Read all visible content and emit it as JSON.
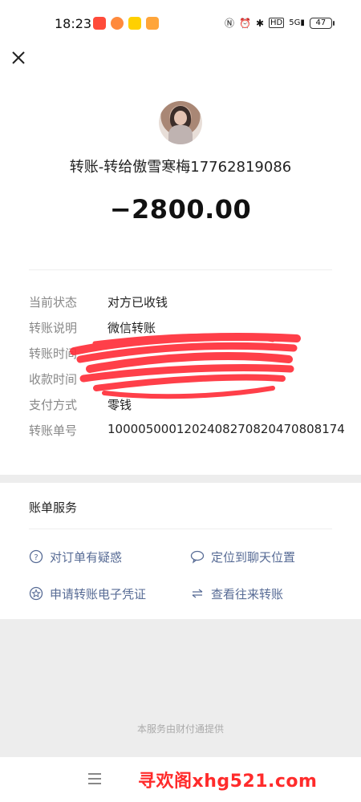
{
  "status_bar": {
    "time": "18:23",
    "network": "5G",
    "hd": "HD",
    "battery": "47"
  },
  "transfer": {
    "title": "转账-转给傲雪寒梅17762819086",
    "amount": "−2800.00"
  },
  "details": [
    {
      "label": "当前状态",
      "value": "对方已收钱"
    },
    {
      "label": "转账说明",
      "value": "微信转账"
    },
    {
      "label": "转账时间",
      "value": ""
    },
    {
      "label": "收款时间",
      "value": ""
    },
    {
      "label": "支付方式",
      "value": "零钱"
    },
    {
      "label": "转账单号",
      "value": "1000050001202408270820470808174"
    }
  ],
  "services": {
    "title": "账单服务",
    "items": [
      {
        "label": "对订单有疑惑",
        "icon": "question-circle-icon"
      },
      {
        "label": "定位到聊天位置",
        "icon": "chat-bubble-icon"
      },
      {
        "label": "申请转账电子凭证",
        "icon": "star-badge-icon"
      },
      {
        "label": "查看往来转账",
        "icon": "swap-arrows-icon"
      }
    ]
  },
  "footer": {
    "provider_note": "本服务由财付通提供"
  },
  "watermark": "寻欢阁xhg521.com",
  "colors": {
    "link": "#576b95",
    "scribble": "#ff2f3a",
    "watermark": "#ff2b2b"
  }
}
